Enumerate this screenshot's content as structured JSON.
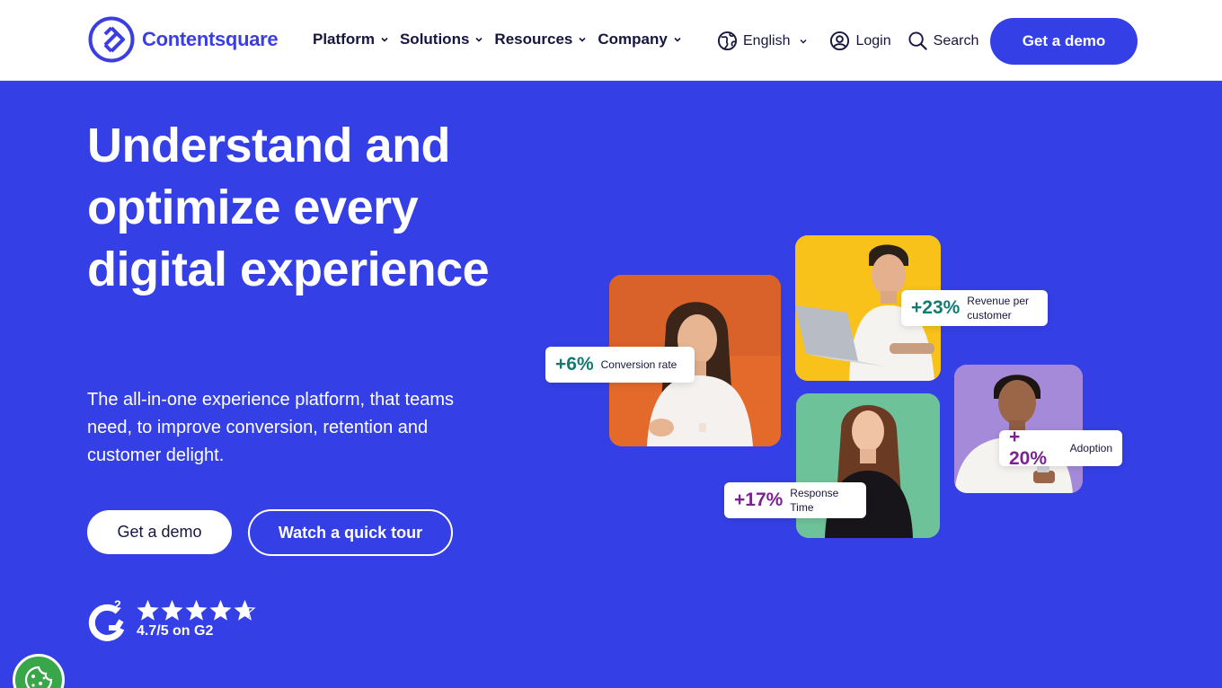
{
  "header": {
    "brand": "Contentsquare",
    "nav": [
      {
        "label": "Platform"
      },
      {
        "label": "Solutions"
      },
      {
        "label": "Resources"
      },
      {
        "label": "Company"
      }
    ],
    "language": "English",
    "login": "Login",
    "search": "Search",
    "cta": "Get a demo"
  },
  "hero": {
    "title": "Understand and optimize every digital experience",
    "subtitle": "The all-in-one experience platform, that teams need, to improve conversion, retention and customer delight.",
    "primary_button": "Get a demo",
    "secondary_button": "Watch a quick tour"
  },
  "rating": {
    "score_text": "4.7/5 on G2",
    "stars": 4.7,
    "max_stars": 5
  },
  "stats": [
    {
      "value": "+6%",
      "label": "Conversion rate"
    },
    {
      "value": "+23%",
      "label": "Revenue per customer"
    },
    {
      "value": "+ 20%",
      "label": "Adoption"
    },
    {
      "value": "+17%",
      "label": "Response Time"
    }
  ],
  "colors": {
    "brand_blue": "#3440e6",
    "teal_stat": "#137a72",
    "purple_stat": "#7a2390",
    "cookie_green": "#3aa64a"
  },
  "icons": {
    "language": "globe-icon",
    "login": "user-circle-icon",
    "search": "search-icon",
    "cookie": "cookie-icon"
  }
}
